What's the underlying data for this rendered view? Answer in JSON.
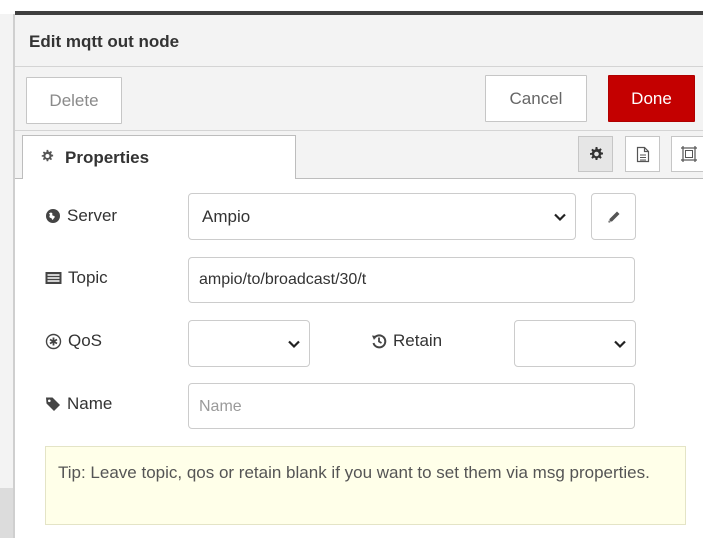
{
  "dialog": {
    "title": "Edit mqtt out node"
  },
  "buttons": {
    "delete": "Delete",
    "cancel": "Cancel",
    "done": "Done"
  },
  "tabs": {
    "active": "Properties"
  },
  "form": {
    "server": {
      "label": "Server",
      "value": "Ampio"
    },
    "topic": {
      "label": "Topic",
      "value": "ampio/to/broadcast/30/t"
    },
    "qos": {
      "label": "QoS",
      "value": ""
    },
    "retain": {
      "label": "Retain",
      "value": ""
    },
    "name": {
      "label": "Name",
      "placeholder": "Name",
      "value": ""
    }
  },
  "tip": "Tip: Leave topic, qos or retain blank if you want to set them via msg properties.",
  "colors": {
    "done_bg": "#c40000",
    "tip_bg": "#ffffe9",
    "panel_bg": "#f3f3f3"
  },
  "icons": [
    "cog-icon",
    "document-icon",
    "frame-icon",
    "globe-icon",
    "pencil-icon",
    "list-icon",
    "qos-icon",
    "history-icon",
    "tag-icon",
    "chevron-down-icon"
  ]
}
